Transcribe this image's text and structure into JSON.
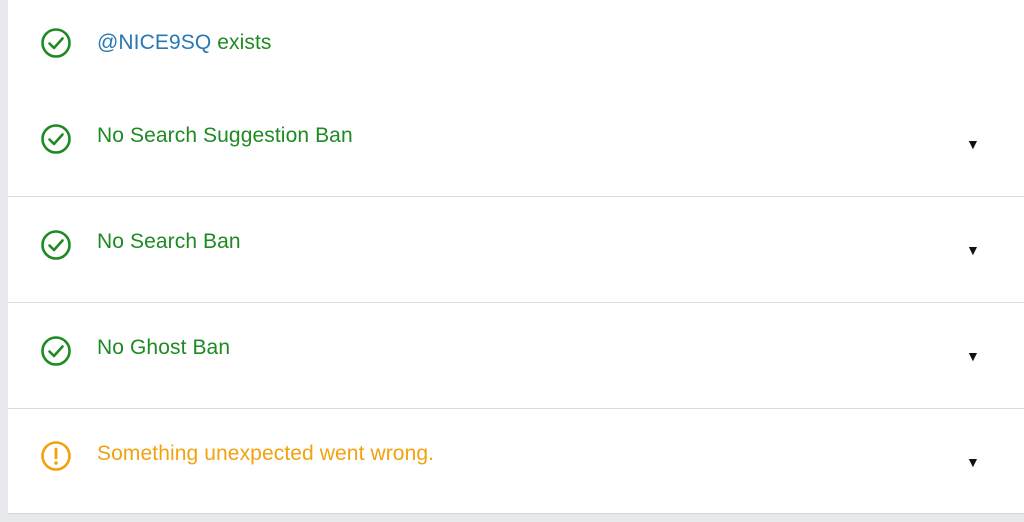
{
  "checks": {
    "exists": {
      "handle": "@NICE9SQ",
      "suffix": " exists",
      "status": "ok",
      "icon": "check-circle-icon"
    },
    "items": [
      {
        "label": "No Search Suggestion Ban",
        "status": "ok",
        "icon": "check-circle-icon",
        "toggle": "▼"
      },
      {
        "label": "No Search Ban",
        "status": "ok",
        "icon": "check-circle-icon",
        "toggle": "▼"
      },
      {
        "label": "No Ghost Ban",
        "status": "ok",
        "icon": "check-circle-icon",
        "toggle": "▼"
      },
      {
        "label": "Something unexpected went wrong.",
        "status": "warning",
        "icon": "alert-circle-icon",
        "toggle": "▼"
      }
    ]
  },
  "colors": {
    "ok": "#1e8a22",
    "warning": "#f2a20e",
    "link": "#2878b4",
    "page_background": "#e7e8ec",
    "card_background": "#ffffff"
  }
}
